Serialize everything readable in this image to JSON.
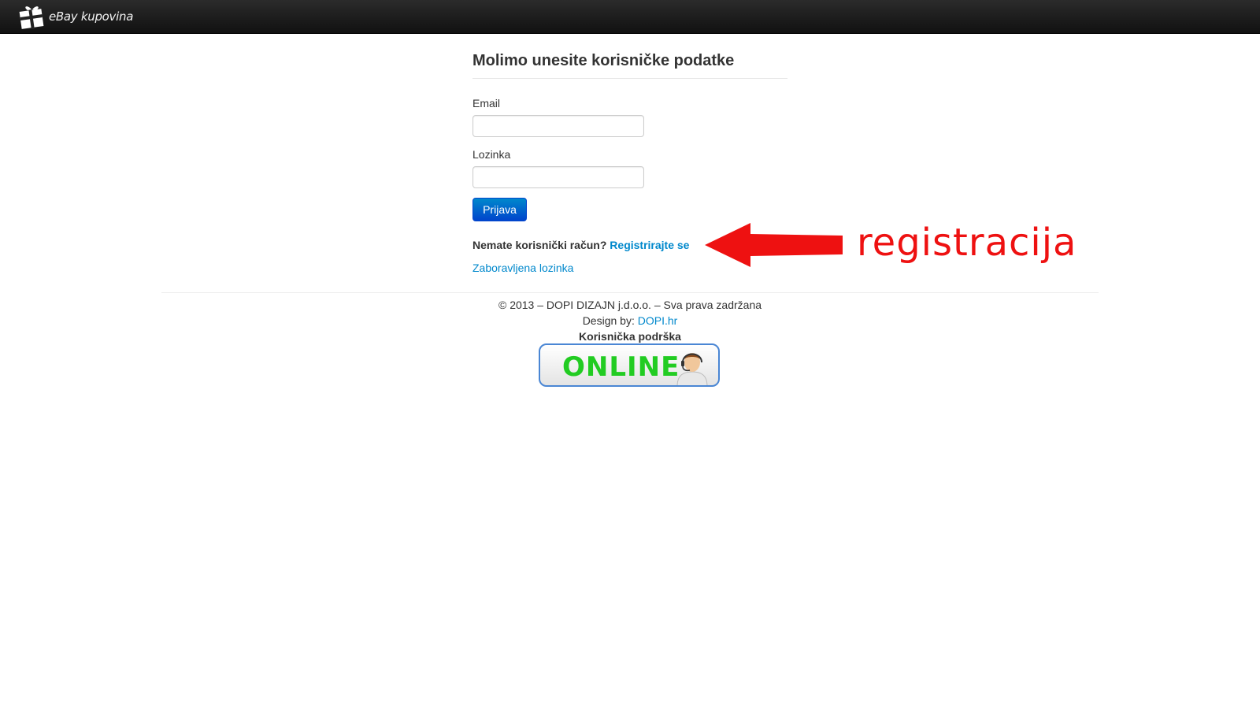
{
  "navbar": {
    "brand": "eBay kupovina"
  },
  "login": {
    "heading": "Molimo unesite korisničke podatke",
    "email_label": "Email",
    "email_value": "",
    "password_label": "Lozinka",
    "password_value": "",
    "submit_label": "Prijava",
    "no_account_text": "Nemate korisnički račun?",
    "register_link": "Registrirajte se",
    "forgot_link": "Zaboravljena lozinka"
  },
  "annotation": {
    "text": "registracija",
    "color": "#ee1111"
  },
  "footer": {
    "copyright": "© 2013 – DOPI DIZAJN j.d.o.o. – Sva prava zadržana",
    "design_by_prefix": "Design by:",
    "design_by_link": "DOPI.hr",
    "support_title": "Korisnička podrška",
    "support_badge": "ONLINE"
  },
  "colors": {
    "link": "#0088cc",
    "primary": "#0055cc",
    "online_green": "#22cc22"
  }
}
